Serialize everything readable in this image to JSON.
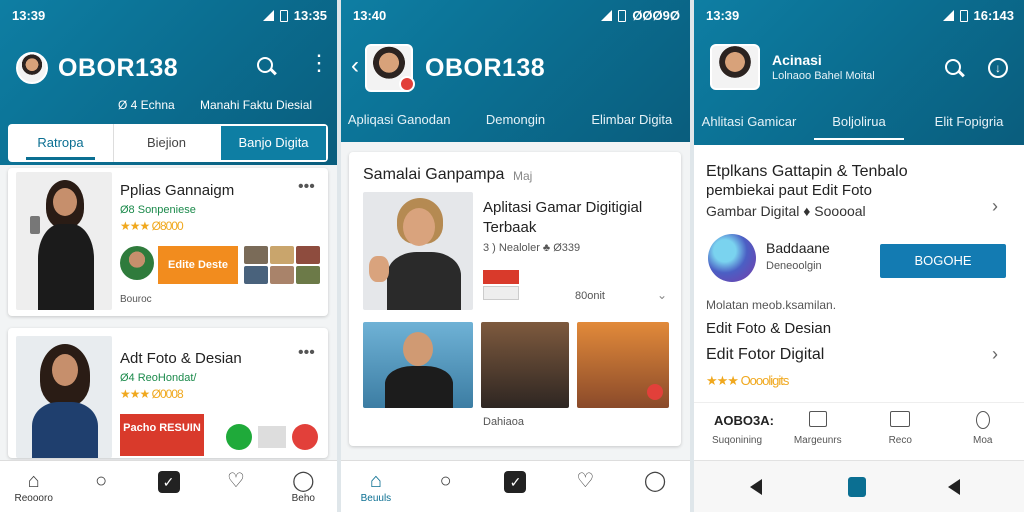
{
  "screens": [
    {
      "status": {
        "time": "13:39",
        "right": "13:35"
      },
      "app_title": "OBOR138",
      "subtitle_left": "Ø 4 Echna",
      "subtitle_right": "Manahi Faktu Diesial",
      "tabs": [
        {
          "label": "Ratropa",
          "active": true
        },
        {
          "label": "Biejion",
          "active": false
        },
        {
          "label": "Banjo Digita",
          "active": false,
          "highlight": true
        }
      ],
      "cards": [
        {
          "title": "Pplias Gannaigm",
          "sub": "Ø8 Sonpeniese",
          "rating": "★★★ Ø8000",
          "banner": "Edite Deste",
          "footer": "Bouroc"
        },
        {
          "title": "Adt Foto & Desian",
          "sub": "Ø4 ReoHondat/",
          "rating": "★★★ Ø0008",
          "banner": "Pacho RESUIN",
          "footer": ""
        }
      ],
      "nav": [
        "Reoooro",
        "",
        "",
        "",
        "Beho"
      ]
    },
    {
      "status": {
        "time": "13:40",
        "right": "ØØØ9Ø"
      },
      "app_title": "OBOR138",
      "tabs": [
        {
          "label": "Apliqasi Ganodan"
        },
        {
          "label": "Demongin"
        },
        {
          "label": "Elimbar Digita"
        }
      ],
      "section_title": "Samalai Ganpampa",
      "section_tag": "Maj",
      "feature": {
        "title": "Aplitasi Gamar Digitigial Terbaak",
        "meta": "3 ) Nealoler ♣ Ø339",
        "side": "80onit"
      },
      "footer": "Dahiaoa",
      "nav": [
        "Beuuls",
        "",
        "",
        "",
        ""
      ]
    },
    {
      "status": {
        "time": "13:39",
        "right": "16:143"
      },
      "header_title": "Acinasi",
      "header_sub": "Lolnaoo Bahel Moital",
      "tabs": [
        {
          "label": "Ahlitasi Gamicar"
        },
        {
          "label": "Boljolirua",
          "active": true
        },
        {
          "label": "Elit Fopigria"
        }
      ],
      "hero_line1": "Etplkans Gattapin & Tenbalo",
      "hero_line2": "pembiekai paut Edit Foto",
      "hero_line3": "Gambar Digital ♦ Sooooal",
      "app_name": "Baddaane",
      "app_sub": "Deneoolgin",
      "action_button": "BOGOHE",
      "desc_small": "Molatan meob.ksamilan.",
      "item1": "Edit Foto & Desian",
      "item2": "Edit Fotor Digital",
      "rating": "★★★ Ooooligits",
      "stats_label": "AOBO3A:",
      "bottom": [
        {
          "label": "Suqonining"
        },
        {
          "label": "Margeunrs"
        },
        {
          "label": "Reco"
        },
        {
          "label": "Moa"
        }
      ]
    }
  ],
  "colors": {
    "brand": "#0b6f92",
    "accent_orange": "#f28c1e",
    "button_blue": "#137bb2"
  }
}
